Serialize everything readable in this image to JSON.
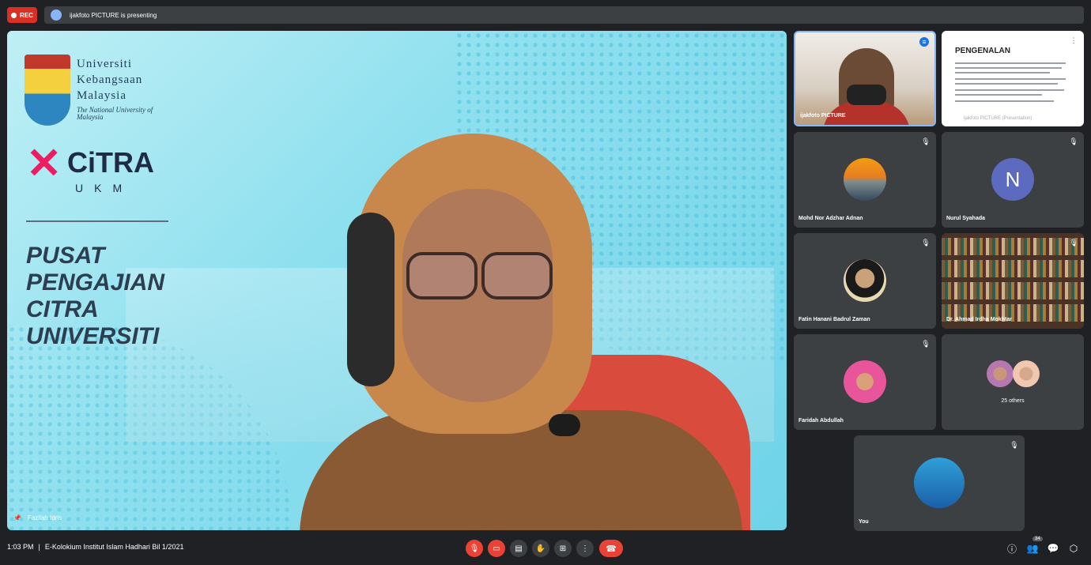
{
  "topbar": {
    "rec_label": "REC",
    "presenting_text": "ijakfoto PICTURE is presenting"
  },
  "main_video": {
    "speaker_name": "Fazilah Idris",
    "background": {
      "university_name_lines": [
        "Universiti",
        "Kebangsaan",
        "Malaysia"
      ],
      "university_subtitle": "The National University of Malaysia",
      "logo_word": "CiTRA",
      "logo_sub": "UKM",
      "center_title_lines": [
        "PUSAT",
        "PENGAJIAN",
        "CITRA",
        "UNIVERSITI"
      ]
    }
  },
  "tiles": [
    {
      "name": "ijakfoto PICTURE",
      "type": "camera",
      "status_icon": "audio-active-icon"
    },
    {
      "name": "ijakfoto PICTURE (Presentation)",
      "type": "presentation",
      "slide_title": "PENGENALAN"
    },
    {
      "name": "Mohd Nor Adzhar Adnan",
      "type": "avatar",
      "muted": true
    },
    {
      "name": "Nurul Syahada",
      "type": "letter",
      "letter": "N",
      "muted": true
    },
    {
      "name": "Fatin Hanani Badrul Zaman",
      "type": "avatar",
      "muted": true
    },
    {
      "name": "Dr. Ahmad Irdha Mokhtar",
      "type": "camera",
      "muted": true
    },
    {
      "name": "Faridah Abdullah",
      "type": "avatar",
      "muted": true
    },
    {
      "name": "25 others",
      "type": "others"
    },
    {
      "name": "You",
      "type": "avatar",
      "muted": true
    }
  ],
  "bottombar": {
    "time": "1:03 PM",
    "separator": "|",
    "meeting_title": "E-Kolokium Institut Islam Hadhari Bil 1/2021",
    "participants_count": "34"
  },
  "colors": {
    "background": "#202124",
    "tile": "#3c4043",
    "danger": "#ea4335",
    "accent": "#8ab4f8"
  }
}
